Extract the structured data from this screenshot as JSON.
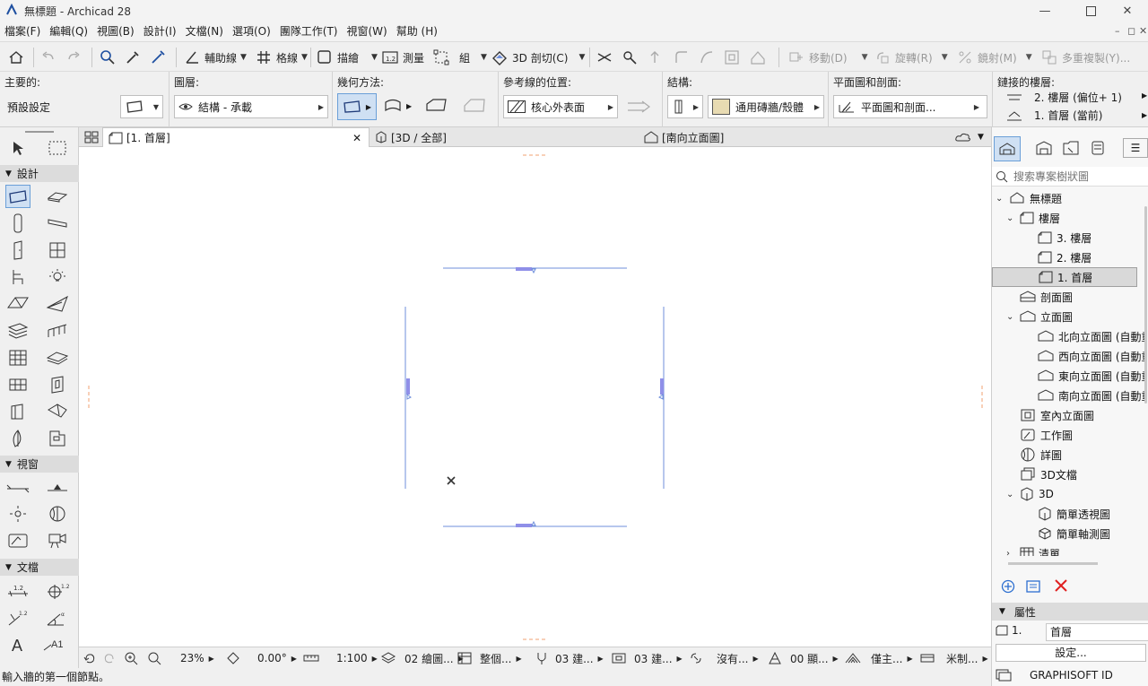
{
  "window": {
    "title": "無標題 - Archicad 28"
  },
  "menu": {
    "items": [
      "檔案(F)",
      "編輯(Q)",
      "視圖(B)",
      "設計(I)",
      "文檔(N)",
      "選項(O)",
      "團隊工作(T)",
      "視窗(W)",
      "幫助 (H)"
    ]
  },
  "toolbar": {
    "guide_line": "輔助線",
    "grid": "格線",
    "trace": "描繪",
    "measure": "測量",
    "group": "組",
    "cut_3d": "3D 剖切(C)",
    "move": "移動(D)",
    "rotate": "旋轉(R)",
    "mirror": "鏡射(M)",
    "multiply": "多重複製(Y)..."
  },
  "infobox": {
    "main_label": "主要的:",
    "main_value": "預設設定",
    "layer_label": "圖層:",
    "layer_value": "結構 - 承載",
    "geometry_label": "幾何方法:",
    "refline_label": "參考線的位置:",
    "refline_value": "核心外表面",
    "structure_label": "結構:",
    "structure_value": "通用磚牆/殼體",
    "plan_section_label": "平面圖和剖面:",
    "plan_section_value": "平面圖和剖面...",
    "linked_label": "鏈接的樓層:",
    "linked_top": "2. 樓層 (偏位+ 1)",
    "linked_bottom": "1. 首層 (當前)"
  },
  "palette": {
    "design_header": "設計",
    "viewpoint_header": "視窗",
    "document_header": "文檔"
  },
  "tabs": [
    {
      "label": "[1. 首層]"
    },
    {
      "label": "[3D / 全部]"
    },
    {
      "label": "[南向立面圖]"
    }
  ],
  "status": {
    "zoom": "23%",
    "angle": "0.00°",
    "scale": "1:100",
    "layer_combo": "02 繪圖...",
    "model_view": "整個...",
    "pen_set": "03 建...",
    "dim": "03 建...",
    "renovation": "沒有...",
    "display": "00 顯...",
    "filter": "僅主...",
    "unit": "米制..."
  },
  "hint": "輸入牆的第一個節點。",
  "navigator": {
    "search_placeholder": "搜索專案樹狀圖",
    "tree": [
      {
        "label": "無標題"
      },
      {
        "label": "樓層"
      },
      {
        "label": "3. 樓層"
      },
      {
        "label": "2. 樓層"
      },
      {
        "label": "1. 首層"
      },
      {
        "label": "剖面圖"
      },
      {
        "label": "立面圖"
      },
      {
        "label": "北向立面圖 (自動重"
      },
      {
        "label": "西向立面圖 (自動重"
      },
      {
        "label": "東向立面圖 (自動重"
      },
      {
        "label": "南向立面圖 (自動重"
      },
      {
        "label": "室內立面圖"
      },
      {
        "label": "工作圖"
      },
      {
        "label": "詳圖"
      },
      {
        "label": "3D文檔"
      },
      {
        "label": "3D"
      },
      {
        "label": "簡單透視圖"
      },
      {
        "label": "簡單軸測圖"
      },
      {
        "label": "清單"
      }
    ],
    "properties_header": "屬性",
    "prop_id": "1.",
    "prop_name": "首層",
    "settings_btn": "設定...",
    "graphisoft": "GRAPHISOFT ID"
  },
  "colors": {
    "accent": "#6f8fdb",
    "selection": "#cfe0f3",
    "red_x": "#e02020"
  }
}
